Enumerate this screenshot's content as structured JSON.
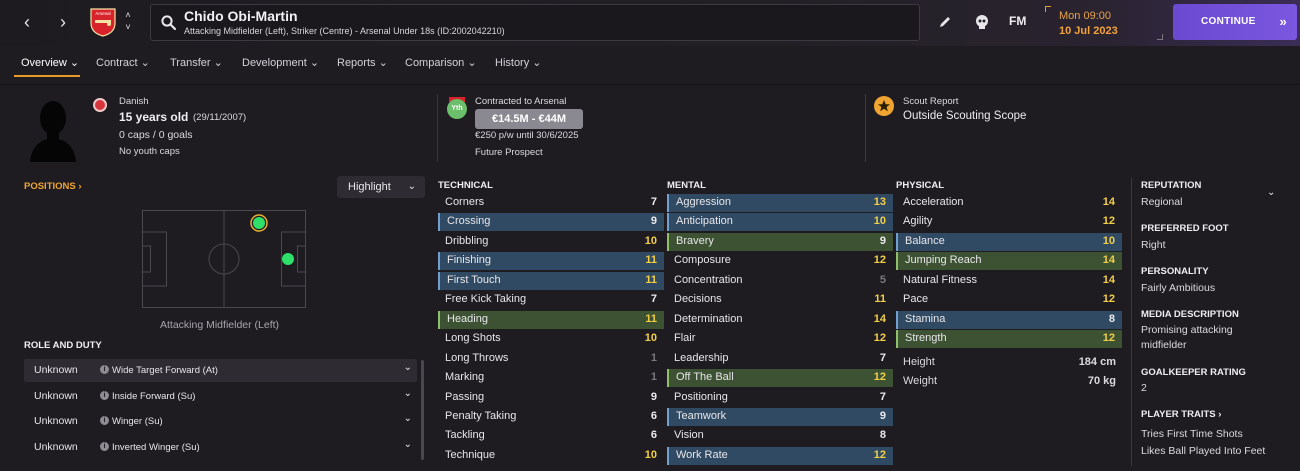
{
  "header": {
    "player_name": "Chido Obi-Martin",
    "player_sub": "Attacking Midfielder (Left), Striker (Centre) - Arsenal Under 18s (ID:2002042210)",
    "fm_label": "FM",
    "date_day": "Mon 09:00",
    "date_date": "10 Jul 2023",
    "continue_label": "CONTINUE",
    "club_badge_text": "Arsenal"
  },
  "tabs": [
    {
      "label": "Overview"
    },
    {
      "label": "Contract"
    },
    {
      "label": "Transfer"
    },
    {
      "label": "Development"
    },
    {
      "label": "Reports"
    },
    {
      "label": "Comparison"
    },
    {
      "label": "History"
    }
  ],
  "info": {
    "nationality": "Danish",
    "age": "15 years old",
    "dob": "(29/11/2007)",
    "caps": "0 caps / 0 goals",
    "youth_caps": "No youth caps",
    "contract_label": "Contracted to Arsenal",
    "yth_badge": "Yth",
    "value_range": "€14.5M - €44M",
    "wage": "€250 p/w until 30/6/2025",
    "prospect": "Future Prospect",
    "scout_label": "Scout Report",
    "scout_value": "Outside Scouting Scope"
  },
  "left": {
    "positions_title": "POSITIONS",
    "highlight_label": "Highlight",
    "position_label": "Attacking Midfielder (Left)",
    "role_title": "ROLE AND DUTY",
    "roles": [
      {
        "level": "Unknown",
        "name": "Wide Target Forward (At)"
      },
      {
        "level": "Unknown",
        "name": "Inside Forward (Su)"
      },
      {
        "level": "Unknown",
        "name": "Winger (Su)"
      },
      {
        "level": "Unknown",
        "name": "Inverted Winger (Su)"
      }
    ]
  },
  "technical": {
    "title": "TECHNICAL",
    "rows": [
      {
        "label": "Corners",
        "value": "7"
      },
      {
        "label": "Crossing",
        "value": "9"
      },
      {
        "label": "Dribbling",
        "value": "10"
      },
      {
        "label": "Finishing",
        "value": "11"
      },
      {
        "label": "First Touch",
        "value": "11"
      },
      {
        "label": "Free Kick Taking",
        "value": "7"
      },
      {
        "label": "Heading",
        "value": "11"
      },
      {
        "label": "Long Shots",
        "value": "10"
      },
      {
        "label": "Long Throws",
        "value": "1"
      },
      {
        "label": "Marking",
        "value": "1"
      },
      {
        "label": "Passing",
        "value": "9"
      },
      {
        "label": "Penalty Taking",
        "value": "6"
      },
      {
        "label": "Tackling",
        "value": "6"
      },
      {
        "label": "Technique",
        "value": "10"
      }
    ]
  },
  "mental": {
    "title": "MENTAL",
    "rows": [
      {
        "label": "Aggression",
        "value": "13"
      },
      {
        "label": "Anticipation",
        "value": "10"
      },
      {
        "label": "Bravery",
        "value": "9"
      },
      {
        "label": "Composure",
        "value": "12"
      },
      {
        "label": "Concentration",
        "value": "5"
      },
      {
        "label": "Decisions",
        "value": "11"
      },
      {
        "label": "Determination",
        "value": "14"
      },
      {
        "label": "Flair",
        "value": "12"
      },
      {
        "label": "Leadership",
        "value": "7"
      },
      {
        "label": "Off The Ball",
        "value": "12"
      },
      {
        "label": "Positioning",
        "value": "7"
      },
      {
        "label": "Teamwork",
        "value": "9"
      },
      {
        "label": "Vision",
        "value": "8"
      },
      {
        "label": "Work Rate",
        "value": "12"
      }
    ]
  },
  "physical": {
    "title": "PHYSICAL",
    "rows": [
      {
        "label": "Acceleration",
        "value": "14"
      },
      {
        "label": "Agility",
        "value": "12"
      },
      {
        "label": "Balance",
        "value": "10"
      },
      {
        "label": "Jumping Reach",
        "value": "14"
      },
      {
        "label": "Natural Fitness",
        "value": "14"
      },
      {
        "label": "Pace",
        "value": "12"
      },
      {
        "label": "Stamina",
        "value": "8"
      },
      {
        "label": "Strength",
        "value": "12"
      }
    ],
    "height_label": "Height",
    "height_value": "184 cm",
    "weight_label": "Weight",
    "weight_value": "70 kg"
  },
  "sidebar": {
    "reputation_label": "REPUTATION",
    "reputation_value": "Regional",
    "foot_label": "PREFERRED FOOT",
    "foot_value": "Right",
    "personality_label": "PERSONALITY",
    "personality_value": "Fairly Ambitious",
    "media_label": "MEDIA DESCRIPTION",
    "media_value": "Promising attacking midfielder",
    "gk_label": "GOALKEEPER RATING",
    "gk_value": "2",
    "traits_label": "PLAYER TRAITS",
    "traits": [
      "Tries First Time Shots",
      "Likes Ball Played Into Feet"
    ]
  },
  "colors": {
    "accent": "#e89b2a",
    "continue": "#7b57e0",
    "highlight_blue": "#2f4a62",
    "highlight_green": "#3c5232",
    "value_yellow": "#f3cf48"
  }
}
